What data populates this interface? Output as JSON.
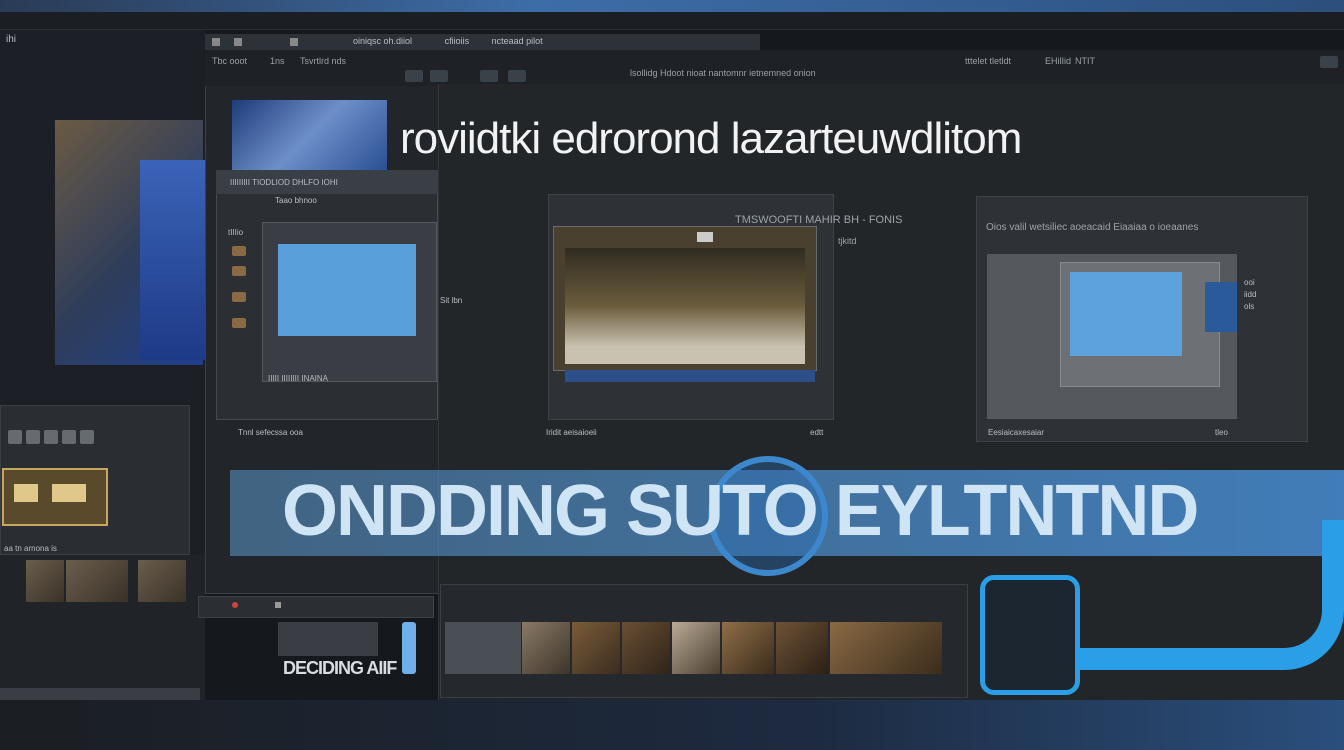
{
  "window": {
    "title_primary": "oiniqsc oh.diiol",
    "title_secondary": "cfiioiis",
    "title_tertiary": "ncteaad pilot"
  },
  "menu": {
    "left_items": [
      "Tbc ooot",
      "1ns",
      "Tsvrtlrd nds"
    ],
    "center_items": [
      "lsollidg Hdoot nioat nantomnr ietnemned onion"
    ],
    "right_items": [
      "tttelet tletldt",
      "EHilIid",
      "NTIT"
    ]
  },
  "main": {
    "heading": "roviidtki edrorond lazarteuwdlitom",
    "center_card_caption": "TMSWOOFTI MAHIR BH - FONIS",
    "center_card_sub": "tjkitd",
    "right_card_caption": "Oios valil    wetsiliec aoeacaid Eiaaiaa   o ioeaanes",
    "right_card_side_labels": [
      "ooi",
      "iidd",
      "ols"
    ],
    "center_card_footer": "Iridit aeisaioeii",
    "center_card_footer_right": "edtt",
    "right_card_footer": "Eesiaicaxesaiar",
    "right_card_footer_right": "tleo"
  },
  "subpanel": {
    "header": "IIIIIIIII TIODLIOD DHLFO IOHI",
    "sub_header": "Taao bhnoo",
    "side_label": "tIIIio",
    "screen_label": "Sit lbn",
    "footer": "IIIII IIIIIIII INAINA",
    "bottom_label": "Tnnl sefecssa ooa"
  },
  "banner": {
    "text": "ONDDING SUTO EYLTNTND"
  },
  "sidebar": {
    "top_label": "ihi",
    "lower_label": "aa tn arnona is",
    "brand_text": "DECIDING AIIF"
  },
  "accent_colors": {
    "primary_blue": "#2a9ee6",
    "screen_blue": "#5aa0d8",
    "banner_text": "#cfe4f5"
  }
}
